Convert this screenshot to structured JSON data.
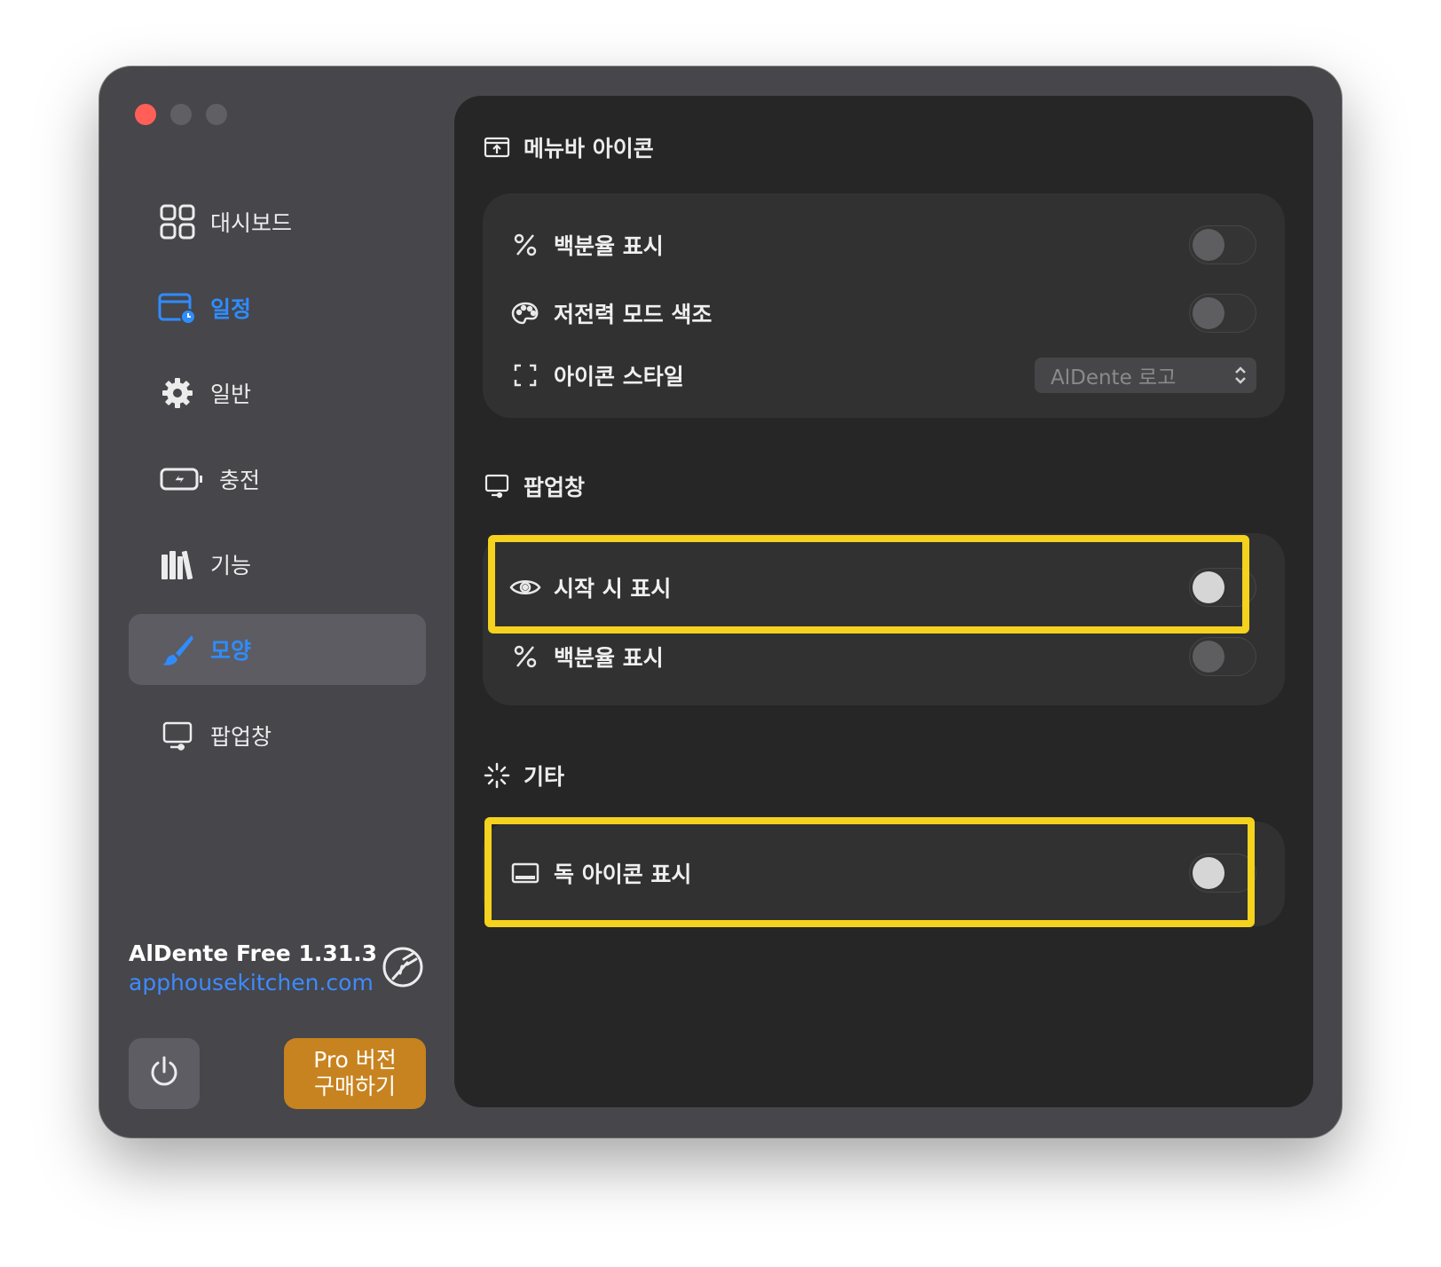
{
  "window": {
    "traffic_lights": [
      "close",
      "minimize",
      "maximize"
    ]
  },
  "sidebar": {
    "items": [
      {
        "label": "대시보드",
        "icon": "dashboard-grid-icon"
      },
      {
        "label": "일정",
        "icon": "calendar-clock-icon",
        "color": "#2f8cff"
      },
      {
        "label": "일반",
        "icon": "gear-icon"
      },
      {
        "label": "충전",
        "icon": "battery-charging-icon"
      },
      {
        "label": "기능",
        "icon": "books-icon"
      },
      {
        "label": "모양",
        "icon": "paintbrush-icon",
        "selected": true,
        "color": "#2f8cff"
      },
      {
        "label": "팝업창",
        "icon": "display-icon"
      }
    ],
    "app_name": "AlDente Free 1.31.3",
    "app_link": "apphousekitchen.com",
    "pro_button_line1": "Pro 버전",
    "pro_button_line2": "구매하기",
    "accent_color": "#c7831f"
  },
  "main": {
    "menubar_section": {
      "title": "메뉴바 아이콘",
      "icon": "menubar-icon",
      "rows": [
        {
          "label": "백분율 표시",
          "icon": "percent-icon",
          "toggle": false
        },
        {
          "label": "저전력 모드 색조",
          "icon": "palette-icon",
          "toggle": false
        },
        {
          "label": "아이콘 스타일",
          "icon": "dashed-square-icon",
          "select_value": "AlDente 로고"
        }
      ]
    },
    "popup_section": {
      "title": "팝업창",
      "icon": "display-icon",
      "rows": [
        {
          "label": "시작 시 표시",
          "icon": "eye-icon",
          "toggle": false,
          "highlighted": true
        },
        {
          "label": "백분율 표시",
          "icon": "percent-icon",
          "toggle": false
        }
      ]
    },
    "other_section": {
      "title": "기타",
      "icon": "loading-spinner-icon",
      "rows": [
        {
          "label": "독 아이콘 표시",
          "icon": "dock-icon",
          "toggle": false,
          "highlighted": true
        }
      ]
    },
    "highlight_color": "#f4d21d"
  }
}
